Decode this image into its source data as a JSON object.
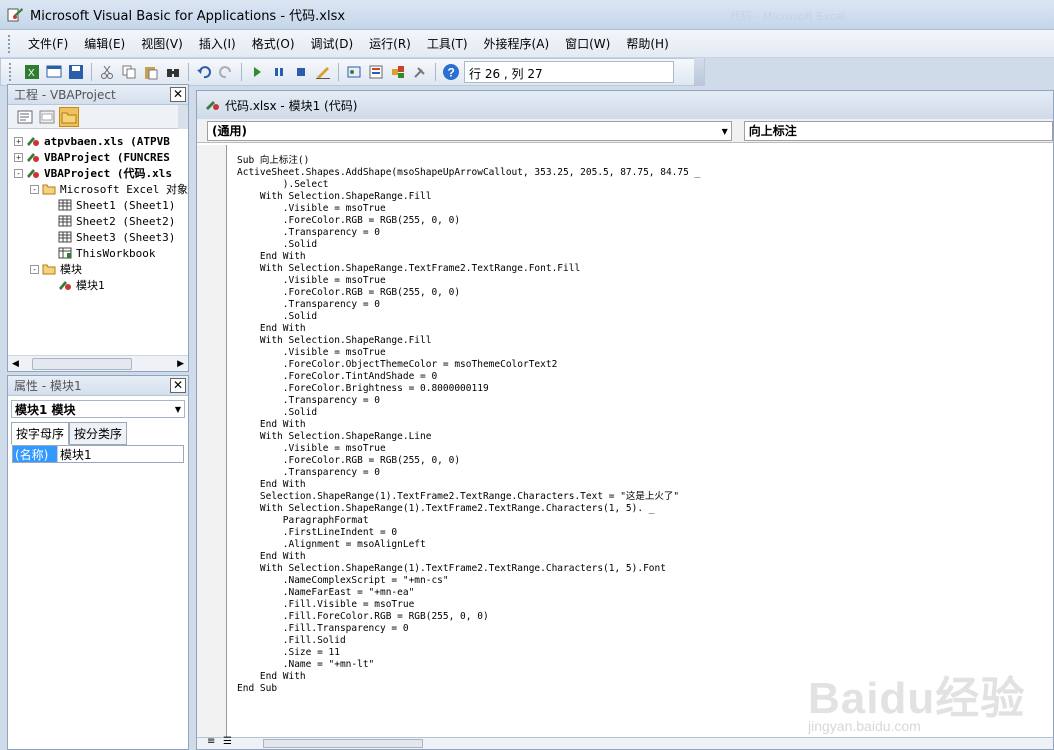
{
  "window": {
    "title": "Microsoft Visual Basic for Applications - 代码.xlsx",
    "background_title": "代码 - Microsoft Excel"
  },
  "menu": [
    "文件(F)",
    "编辑(E)",
    "视图(V)",
    "插入(I)",
    "格式(O)",
    "调试(D)",
    "运行(R)",
    "工具(T)",
    "外接程序(A)",
    "窗口(W)",
    "帮助(H)"
  ],
  "toolbar": {
    "icons": [
      "excel-view-icon",
      "insert-userform-icon",
      "save-icon",
      "cut-icon",
      "copy-icon",
      "paste-icon",
      "find-icon",
      "undo-icon",
      "redo-icon",
      "run-icon",
      "break-icon",
      "reset-icon",
      "design-mode-icon",
      "project-explorer-icon",
      "properties-window-icon",
      "object-browser-icon",
      "toolbox-icon",
      "help-icon"
    ],
    "position": "行 26 , 列 27"
  },
  "project": {
    "title": "工程 - VBAProject",
    "tree": [
      {
        "label": "atpvbaen.xls (ATPVB",
        "level": 0,
        "expander": "+",
        "bold": true
      },
      {
        "label": "VBAProject (FUNCRES",
        "level": 0,
        "expander": "+",
        "bold": true
      },
      {
        "label": "VBAProject (代码.xls",
        "level": 0,
        "expander": "-",
        "bold": true
      },
      {
        "label": "Microsoft Excel 对象",
        "level": 1,
        "expander": "-",
        "bold": false
      },
      {
        "label": "Sheet1 (Sheet1)",
        "level": 2,
        "expander": "",
        "bold": false
      },
      {
        "label": "Sheet2 (Sheet2)",
        "level": 2,
        "expander": "",
        "bold": false
      },
      {
        "label": "Sheet3 (Sheet3)",
        "level": 2,
        "expander": "",
        "bold": false
      },
      {
        "label": "ThisWorkbook",
        "level": 2,
        "expander": "",
        "bold": false
      },
      {
        "label": "模块",
        "level": 1,
        "expander": "-",
        "bold": false
      },
      {
        "label": "模块1",
        "level": 2,
        "expander": "",
        "bold": false
      }
    ]
  },
  "properties": {
    "title": "属性 - 模块1",
    "object": "模块1 模块",
    "tabs": [
      "按字母序",
      "按分类序"
    ],
    "name_key": "(名称)",
    "name_value": "模块1"
  },
  "editor": {
    "title": "代码.xlsx - 模块1 (代码)",
    "object_combo": "(通用)",
    "proc_combo": "向上标注",
    "lines": [
      "Sub 向上标注()",
      "ActiveSheet.Shapes.AddShape(msoShapeUpArrowCallout, 353.25, 205.5, 87.75, 84.75 _",
      "        ).Select",
      "    With Selection.ShapeRange.Fill",
      "        .Visible = msoTrue",
      "        .ForeColor.RGB = RGB(255, 0, 0)",
      "        .Transparency = 0",
      "        .Solid",
      "    End With",
      "    With Selection.ShapeRange.TextFrame2.TextRange.Font.Fill",
      "        .Visible = msoTrue",
      "        .ForeColor.RGB = RGB(255, 0, 0)",
      "        .Transparency = 0",
      "        .Solid",
      "    End With",
      "    With Selection.ShapeRange.Fill",
      "        .Visible = msoTrue",
      "        .ForeColor.ObjectThemeColor = msoThemeColorText2",
      "        .ForeColor.TintAndShade = 0",
      "        .ForeColor.Brightness = 0.8000000119",
      "        .Transparency = 0",
      "        .Solid",
      "    End With",
      "    With Selection.ShapeRange.Line",
      "        .Visible = msoTrue",
      "        .ForeColor.RGB = RGB(255, 0, 0)",
      "        .Transparency = 0",
      "    End With",
      "    Selection.ShapeRange(1).TextFrame2.TextRange.Characters.Text = \"这是上火了\"",
      "    With Selection.ShapeRange(1).TextFrame2.TextRange.Characters(1, 5). _",
      "        ParagraphFormat",
      "        .FirstLineIndent = 0",
      "        .Alignment = msoAlignLeft",
      "    End With",
      "    With Selection.ShapeRange(1).TextFrame2.TextRange.Characters(1, 5).Font",
      "        .NameComplexScript = \"+mn-cs\"",
      "        .NameFarEast = \"+mn-ea\"",
      "        .Fill.Visible = msoTrue",
      "        .Fill.ForeColor.RGB = RGB(255, 0, 0)",
      "        .Fill.Transparency = 0",
      "        .Fill.Solid",
      "        .Size = 11",
      "        .Name = \"+mn-lt\"",
      "    End With",
      "End Sub"
    ]
  },
  "watermark": {
    "brand": "Baidu经验",
    "url": "jingyan.baidu.com"
  },
  "colors": {
    "keyword": "#00008b",
    "selection": "#3399ff",
    "chrome": "#cfdbe9"
  }
}
